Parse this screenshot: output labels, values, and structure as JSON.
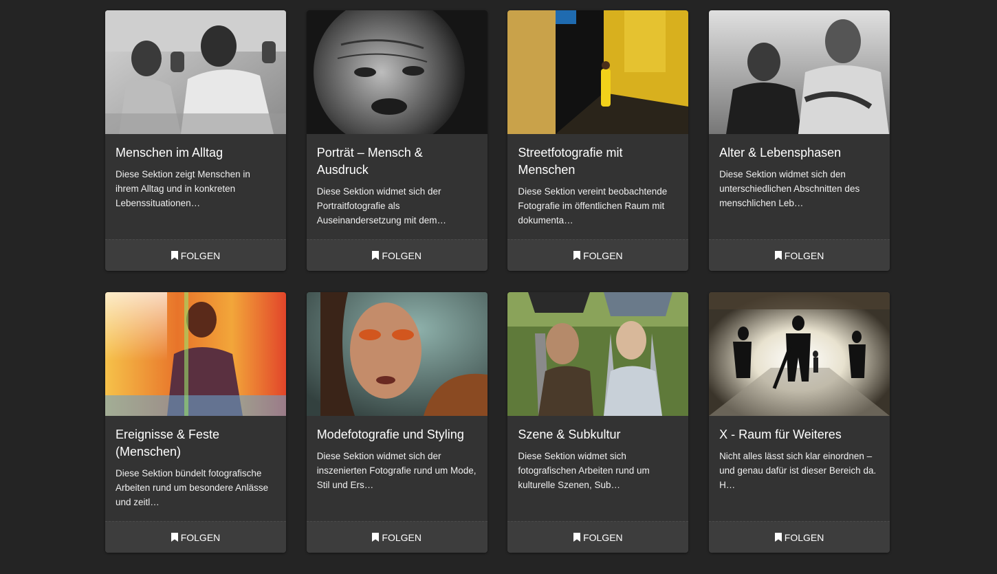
{
  "follow_label": "FOLGEN",
  "cards": [
    {
      "title": "Menschen im Alltag",
      "desc": "Diese Sektion zeigt Menschen in ihrem Alltag und in konkreten Lebenssituationen…",
      "image": "bw-elderly-woman-man-thumbs-up"
    },
    {
      "title": "Porträt – Mensch & Ausdruck",
      "desc": "Diese Sektion widmet sich der Portraitfotografie als Auseinandersetzung mit dem…",
      "image": "bw-old-man-wrinkled-face"
    },
    {
      "title": "Streetfotografie mit Menschen",
      "desc": "Diese Sektion vereint beobachtende Fotografie im öffentlichen Raum mit dokumenta…",
      "image": "woman-yellow-outfit-alley"
    },
    {
      "title": "Alter & Lebensphasen",
      "desc": "Diese Sektion widmet sich den unterschiedlichen Abschnitten des menschlichen Leb…",
      "image": "bw-boy-and-man-skateboard"
    },
    {
      "title": "Ereignisse & Feste (Menschen)",
      "desc": "Diese Sektion bündelt fotografische Arbeiten rund um besondere Anlässe und zeitl…",
      "image": "colorful-light-leak-festival"
    },
    {
      "title": "Modefotografie und Styling",
      "desc": "Diese Sektion widmet sich der inszenierten Fotografie rund um Mode, Stil und Ers…",
      "image": "fashion-portrait-orange-makeup"
    },
    {
      "title": "Szene & Subkultur",
      "desc": "Diese Sektion widmet sich fotografischen Arbeiten rund um kulturelle Szenen, Sub…",
      "image": "cosplay-couple-silver-hair"
    },
    {
      "title": "X - Raum für Weiteres",
      "desc": "Nicht alles lässt sich klar einordnen – und genau dafür ist dieser Bereich da. H…",
      "image": "tunnel-silhouettes-bright-light"
    }
  ]
}
